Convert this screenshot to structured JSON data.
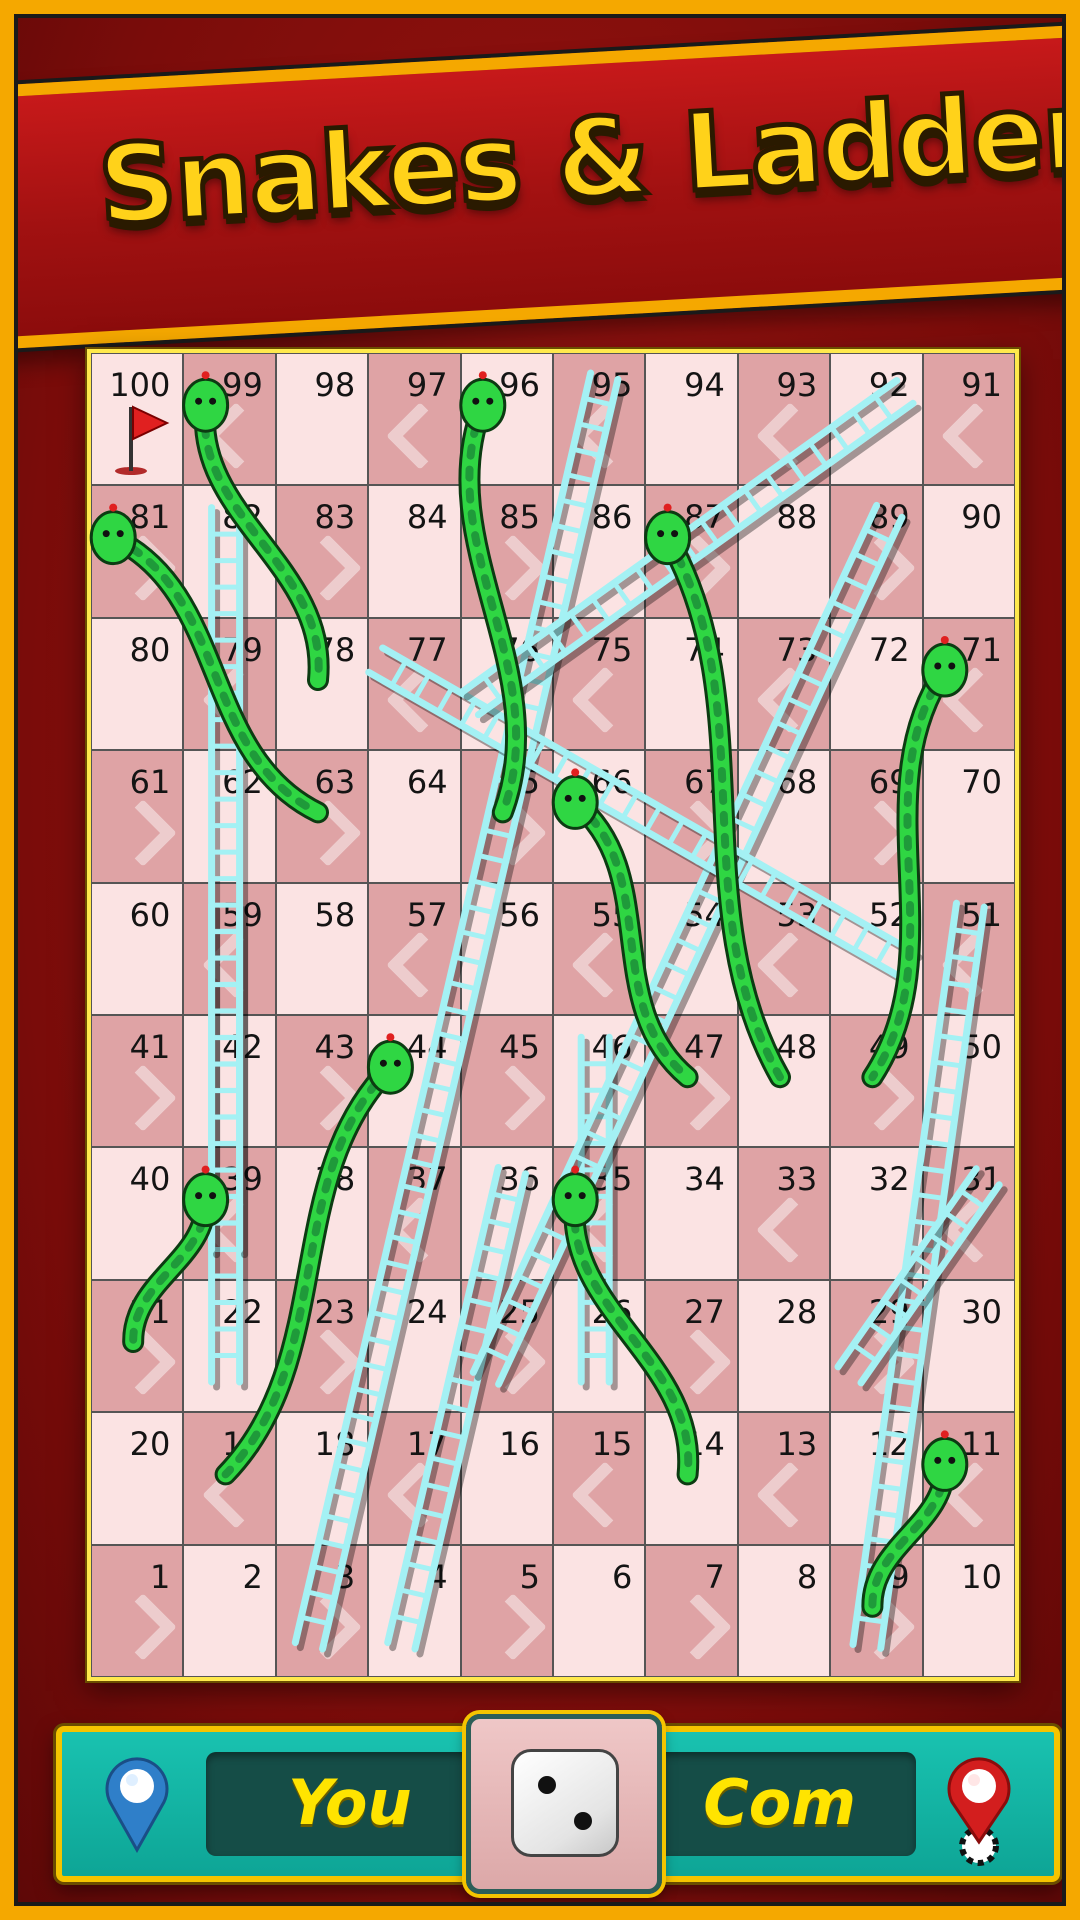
{
  "title": "Snakes & Ladders",
  "board": {
    "rows": [
      [
        100,
        99,
        98,
        97,
        96,
        95,
        94,
        93,
        92,
        91
      ],
      [
        81,
        82,
        83,
        84,
        85,
        86,
        87,
        88,
        89,
        90
      ],
      [
        80,
        79,
        78,
        77,
        76,
        75,
        74,
        73,
        72,
        71
      ],
      [
        61,
        62,
        63,
        64,
        65,
        66,
        67,
        68,
        69,
        70
      ],
      [
        60,
        59,
        58,
        57,
        56,
        55,
        54,
        53,
        52,
        51
      ],
      [
        41,
        42,
        43,
        44,
        45,
        46,
        47,
        48,
        49,
        50
      ],
      [
        40,
        39,
        38,
        37,
        36,
        35,
        34,
        33,
        32,
        31
      ],
      [
        21,
        22,
        23,
        24,
        25,
        26,
        27,
        28,
        29,
        30
      ],
      [
        20,
        19,
        18,
        17,
        16,
        15,
        14,
        13,
        12,
        11
      ],
      [
        1,
        2,
        3,
        4,
        5,
        6,
        7,
        8,
        9,
        10
      ]
    ],
    "finish_icon": "flag-icon",
    "colors": {
      "light_cell": "#fbe3e3",
      "dark_cell": "#dfa3a5",
      "snake_body": "#2fd643",
      "snake_spots": "#1f9a3a",
      "ladder": "#a4f1f4"
    }
  },
  "ladders": [
    {
      "from": 3,
      "to": 95
    },
    {
      "from": 22,
      "to": 59
    },
    {
      "from": 4,
      "to": 36
    },
    {
      "from": 26,
      "to": 46
    },
    {
      "from": 9,
      "to": 51
    },
    {
      "from": 39,
      "to": 82
    },
    {
      "from": 25,
      "to": 89
    },
    {
      "from": 29,
      "to": 31
    },
    {
      "from": 52,
      "to": 77
    },
    {
      "from": 92,
      "to": 76
    }
  ],
  "snakes": [
    {
      "head": 99,
      "tail": 78
    },
    {
      "head": 81,
      "tail": 63
    },
    {
      "head": 96,
      "tail": 65
    },
    {
      "head": 87,
      "tail": 48
    },
    {
      "head": 71,
      "tail": 49
    },
    {
      "head": 66,
      "tail": 47
    },
    {
      "head": 44,
      "tail": 19
    },
    {
      "head": 39,
      "tail": 21
    },
    {
      "head": 35,
      "tail": 14
    },
    {
      "head": 11,
      "tail": 9
    }
  ],
  "players": {
    "you": {
      "label": "You",
      "pin_color": "#2f7fc9",
      "pin_icon": "location-pin-icon"
    },
    "com": {
      "label": "Com",
      "pin_color": "#d31e1e",
      "pin_icon": "location-pin-icon"
    }
  },
  "dice": {
    "value": 2,
    "icon": "dice-icon"
  }
}
